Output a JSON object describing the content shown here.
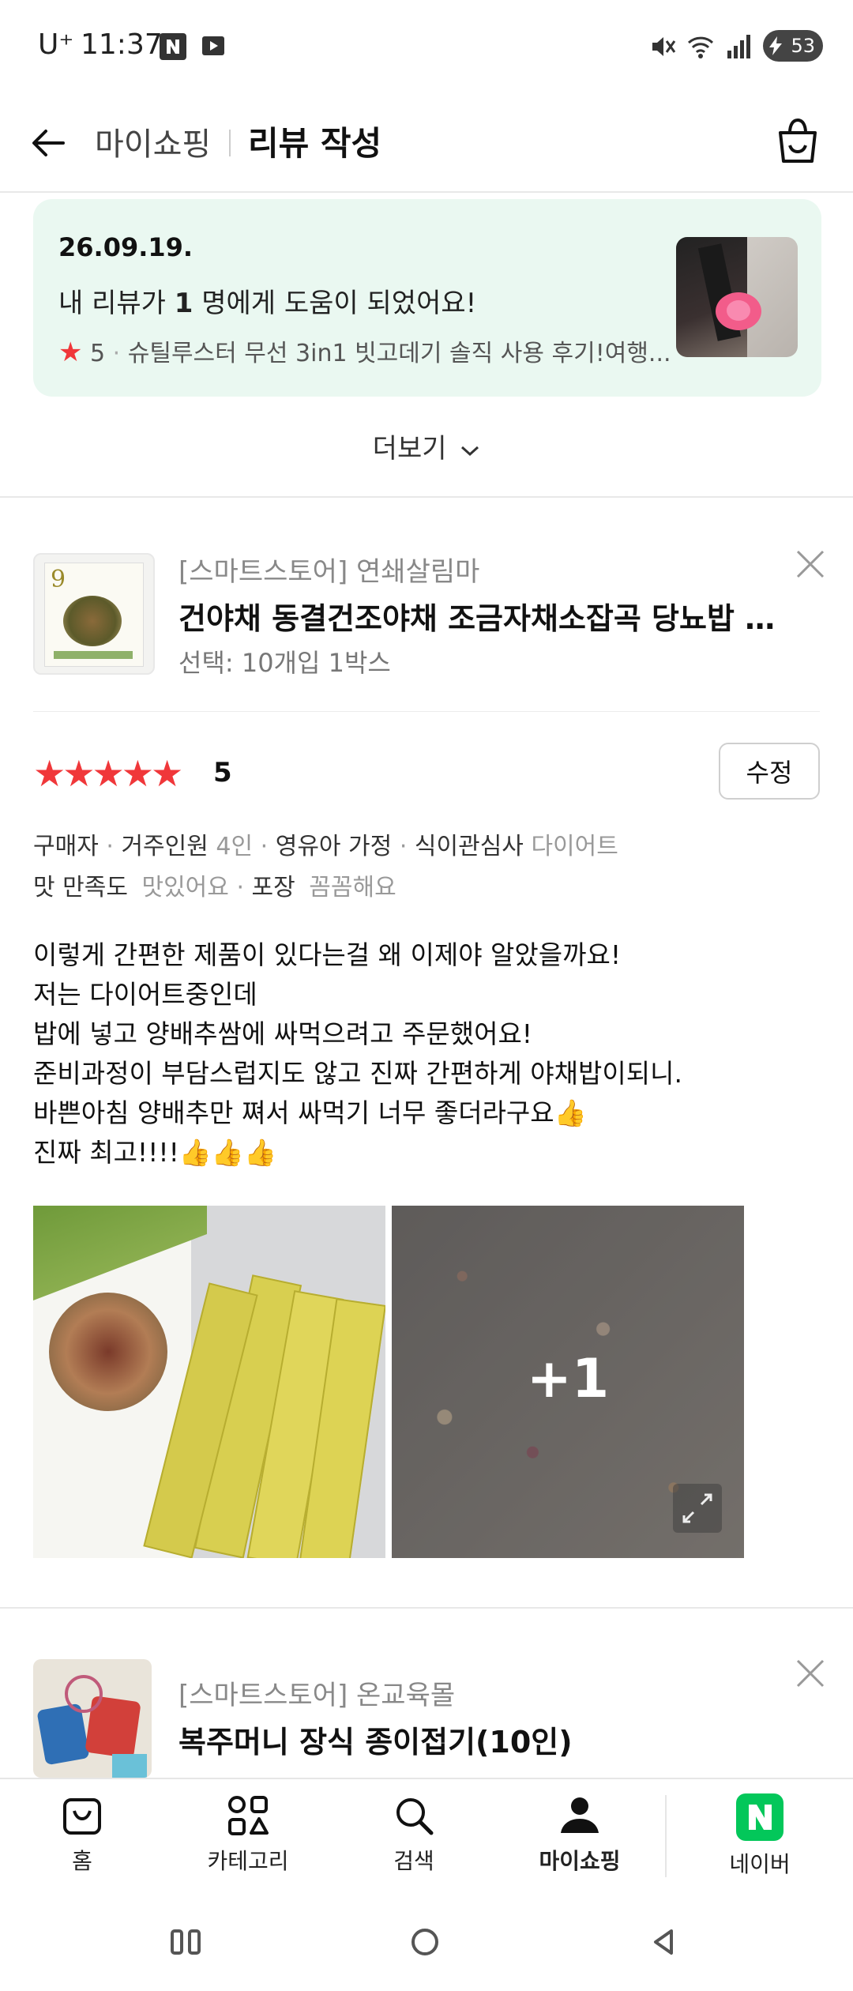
{
  "status_bar": {
    "carrier": "U⁺",
    "time": "11:37",
    "battery": "53"
  },
  "header": {
    "breadcrumb": "마이쇼핑",
    "title": "리뷰 작성"
  },
  "notice": {
    "date": "26.09.19.",
    "message_prefix": "내 리뷰가 ",
    "message_count": "1",
    "message_suffix": " 명에게 도움이 되었어요!",
    "star_rating": "5",
    "review_title": "슈틸루스터 무선 3in1 빗고데기 솔직 사용 후기!여행..."
  },
  "more_label": "더보기",
  "product1": {
    "shop": "[스마트스토어] 연쇄살림마",
    "name": "건야채 동결건조야채 조금자채소잡곡 당뇨밥 ...",
    "option": "선택: 10개입 1박스",
    "thumb_number": "9"
  },
  "review": {
    "stars": "★★★★★",
    "rating": "5",
    "edit_label": "수정",
    "meta_line1": {
      "buyer_label": "구매자",
      "household_label": "거주인원",
      "household_value": "4인",
      "family_label": "영유아 가정",
      "diet_label": "식이관심사",
      "diet_value": "다이어트"
    },
    "meta_line2": {
      "taste_label": "맛 만족도",
      "taste_value": "맛있어요",
      "pack_label": "포장",
      "pack_value": "꼼꼼해요"
    },
    "text": "이렇게 간편한 제품이 있다는걸 왜 이제야 알았을까요!\n저는 다이어트중인데\n밥에 넣고 양배추쌈에 싸먹으려고 주문했어요!\n준비과정이 부담스럽지도 않고 진짜 간편하게 야채밥이되니.\n바쁜아침 양배추만 쪄서 싸먹기 너무 좋더라구요👍\n진짜 최고!!!!👍👍👍",
    "extra_photos": "+1"
  },
  "product2": {
    "shop": "[스마트스토어] 온교육몰",
    "name": "복주머니 장식 종이접기(10인)"
  },
  "bottom_nav": [
    {
      "label": "홈",
      "icon": "bag-icon"
    },
    {
      "label": "카테고리",
      "icon": "category-icon"
    },
    {
      "label": "검색",
      "icon": "search-icon"
    },
    {
      "label": "마이쇼핑",
      "icon": "person-icon",
      "active": true
    },
    {
      "label": "네이버",
      "icon": "naver-icon"
    }
  ],
  "colors": {
    "accent_red": "#f0373a",
    "notice_bg": "#eaf8f1",
    "naver_green": "#03c75a"
  }
}
